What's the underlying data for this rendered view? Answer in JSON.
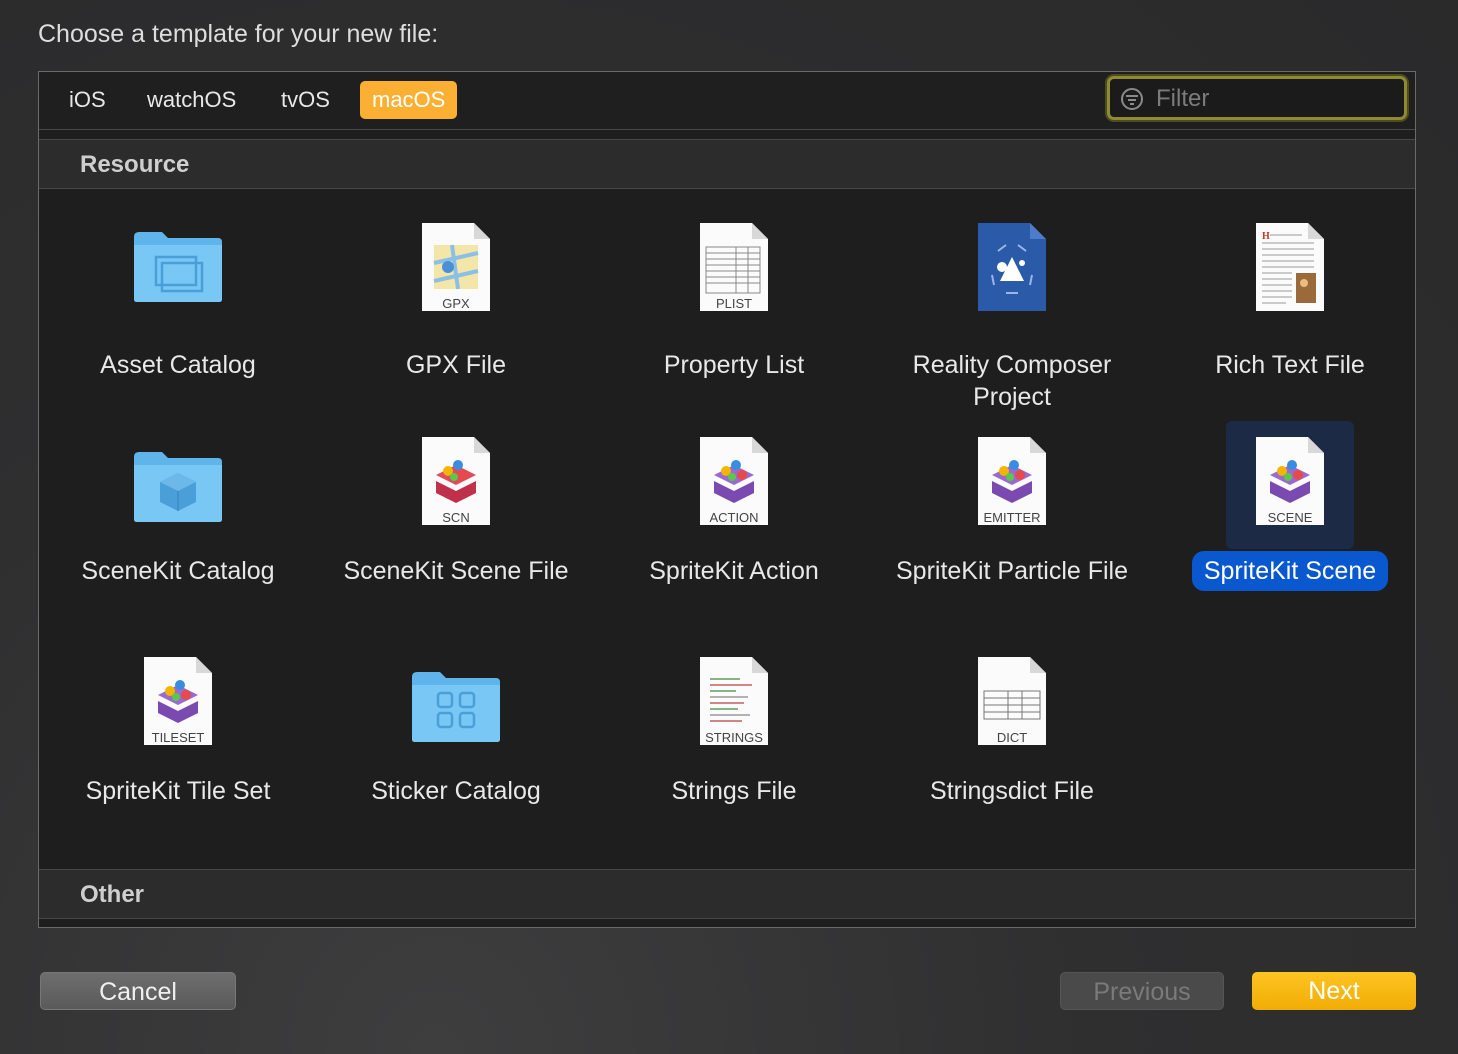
{
  "prompt": "Choose a template for your new file:",
  "tabs": [
    {
      "label": "iOS",
      "active": false
    },
    {
      "label": "watchOS",
      "active": false
    },
    {
      "label": "tvOS",
      "active": false
    },
    {
      "label": "macOS",
      "active": true
    }
  ],
  "filter": {
    "placeholder": "Filter",
    "value": ""
  },
  "sections": [
    {
      "title": "Resource",
      "items": [
        {
          "label": "Asset Catalog",
          "icon": "folder-asset-catalog-icon"
        },
        {
          "label": "GPX File",
          "icon": "gpx-file-icon",
          "badge": "GPX"
        },
        {
          "label": "Property List",
          "icon": "plist-file-icon",
          "badge": "PLIST"
        },
        {
          "label": "Reality Composer Project",
          "icon": "reality-composer-icon"
        },
        {
          "label": "Rich Text File",
          "icon": "rich-text-file-icon"
        },
        {
          "label": "SceneKit Catalog",
          "icon": "folder-scenekit-catalog-icon"
        },
        {
          "label": "SceneKit Scene File",
          "icon": "scenekit-file-icon",
          "badge": "SCN"
        },
        {
          "label": "SpriteKit Action",
          "icon": "spritekit-action-icon",
          "badge": "ACTION"
        },
        {
          "label": "SpriteKit Particle File",
          "icon": "spritekit-emitter-icon",
          "badge": "EMITTER"
        },
        {
          "label": "SpriteKit Scene",
          "icon": "spritekit-scene-icon",
          "badge": "SCENE",
          "selected": true
        },
        {
          "label": "SpriteKit Tile Set",
          "icon": "spritekit-tileset-icon",
          "badge": "TILESET"
        },
        {
          "label": "Sticker Catalog",
          "icon": "folder-sticker-catalog-icon"
        },
        {
          "label": "Strings File",
          "icon": "strings-file-icon",
          "badge": "STRINGS"
        },
        {
          "label": "Stringsdict File",
          "icon": "stringsdict-file-icon",
          "badge": "DICT"
        }
      ]
    },
    {
      "title": "Other",
      "items": []
    }
  ],
  "buttons": {
    "cancel": "Cancel",
    "previous": "Previous",
    "next": "Next"
  },
  "colors": {
    "accent_tab": "#fbb034",
    "selection": "#0a58d0",
    "next_button": "#f7b70f"
  }
}
